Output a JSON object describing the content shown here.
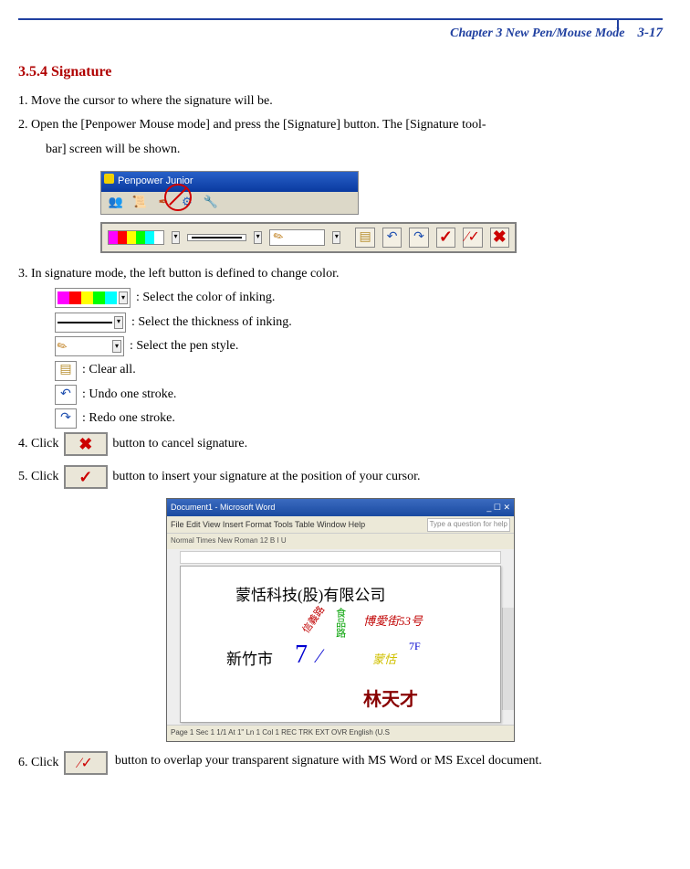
{
  "header": {
    "chapter": "Chapter 3 New Pen/Mouse Mode",
    "page": "3-17"
  },
  "section": {
    "title": "3.5.4 Signature"
  },
  "steps": {
    "s1": "1. Move the cursor to where the signature will be.",
    "s2a": "2. Open the [Penpower Mouse mode] and press the [Signature] button. The [Signature tool-",
    "s2b": "bar] screen will be shown.",
    "s3": "3. In signature mode, the left button is defined to change color.",
    "opt_color": " : Select the color of inking.",
    "opt_thick": ": Select the thickness of inking.",
    "opt_pen": ": Select the pen style.",
    "opt_clear": ": Clear all.",
    "opt_undo": " : Undo one stroke.",
    "opt_redo": ": Redo one stroke.",
    "s4a": "4.  Click ",
    "s4b": " button to cancel signature.",
    "s5a": "5. Click ",
    "s5b": " button to insert your signature at the position of your cursor.",
    "s6a": "6. Click ",
    "s6b": " button to overlap your transparent signature with MS Word or MS Excel document."
  },
  "junior": {
    "title": "Penpower Junior"
  },
  "word": {
    "title": "Document1 - Microsoft Word",
    "menus": "File  Edit  View  Insert  Format  Tools  Table  Window  Help",
    "help": "Type a question for help",
    "toolbar": "Normal      Times New Roman   12    B  I  U",
    "line1": "蒙恬科技(股)有限公司",
    "line2": "新竹市",
    "ann1": "信義路",
    "ann2": "食品路",
    "ann3": "博愛街53号",
    "ann4": "7F",
    "ann5": "蒙恬",
    "sig": "林天才",
    "status": "Page 1    Sec 1    1/1    At 1\"    Ln 1    Col 1        REC  TRK  EXT  OVR   English (U.S"
  },
  "colors": {
    "palette": [
      "#ff00ff",
      "#ff0000",
      "#ffff00",
      "#00ff00",
      "#00ffff",
      "#ffffff"
    ]
  }
}
